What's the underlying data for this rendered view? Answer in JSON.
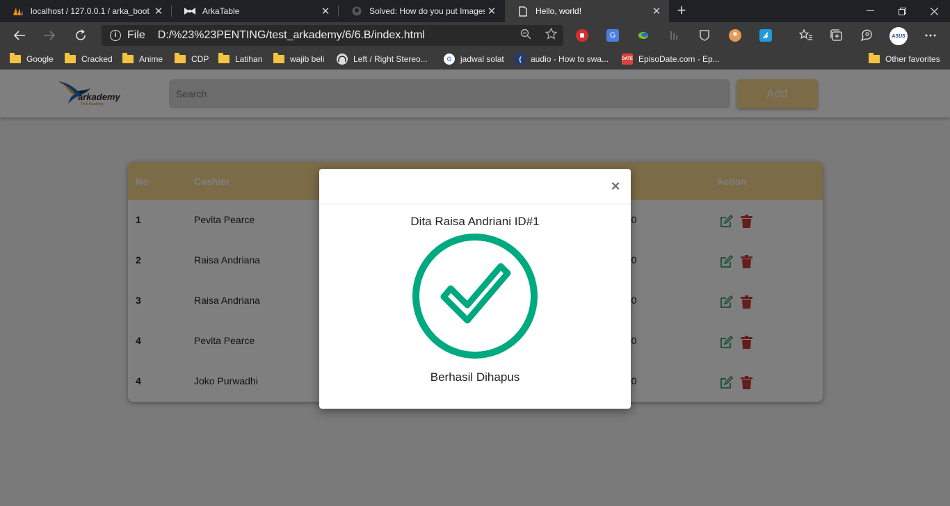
{
  "browser": {
    "tabs": [
      {
        "title": "localhost / 127.0.0.1 / arka_boot",
        "favicon": "phpmyadmin-icon",
        "close": "✕"
      },
      {
        "title": "ArkaTable",
        "favicon": "bow-icon",
        "close": "✕"
      },
      {
        "title": "Solved: How do you put Images",
        "favicon": "github-icon",
        "close": "✕"
      },
      {
        "title": "Hello, world!",
        "favicon": "page-icon",
        "close": "✕"
      }
    ],
    "new_tab": "+",
    "address": {
      "info": "i",
      "scheme": "File",
      "url": "D:/%23%23PENTING/test_arkademy/6/6.B/index.html"
    },
    "profile_label": "ASUS",
    "bookmarks": [
      {
        "label": "Google",
        "icon": "folder-icon"
      },
      {
        "label": "Cracked",
        "icon": "folder-icon"
      },
      {
        "label": "Anime",
        "icon": "folder-icon"
      },
      {
        "label": "CDP",
        "icon": "folder-icon"
      },
      {
        "label": "Latihan",
        "icon": "folder-icon"
      },
      {
        "label": "wajib beli",
        "icon": "folder-icon"
      },
      {
        "label": "Left / Right Stereo...",
        "icon": "headphones-icon"
      },
      {
        "label": "jadwal solat",
        "icon": "google-icon"
      },
      {
        "label": "audio - How to swa...",
        "icon": "stackexchange-icon"
      },
      {
        "label": "EpisoDate.com - Ep...",
        "icon": "calendar-icon"
      }
    ],
    "other_favorites": "Other favorites"
  },
  "app": {
    "logo_text": "arkademy",
    "logo_sub": "Tech Academy",
    "search_placeholder": "Search",
    "add_label": "Add"
  },
  "table": {
    "headers": {
      "no": "No",
      "cashier": "Cashier",
      "action": "Action"
    },
    "rows": [
      {
        "no": "1",
        "cashier": "Pevita Pearce",
        "price_tail": ".00"
      },
      {
        "no": "2",
        "cashier": "Raisa Andriana",
        "price_tail": ".00"
      },
      {
        "no": "3",
        "cashier": "Raisa Andriana",
        "price_tail": ".00"
      },
      {
        "no": "4",
        "cashier": "Pevita Pearce",
        "price_tail": ".00"
      },
      {
        "no": "4",
        "cashier": "Joko Purwadhi",
        "price_tail": ".00"
      }
    ]
  },
  "modal": {
    "close": "×",
    "title": "Dita Raisa Andriani ID#1",
    "message": "Berhasil Dihapus",
    "check_color": "#00a97f"
  },
  "colors": {
    "accent": "#f7d88f",
    "edit": "#2e9b62",
    "delete": "#c93b3b"
  }
}
